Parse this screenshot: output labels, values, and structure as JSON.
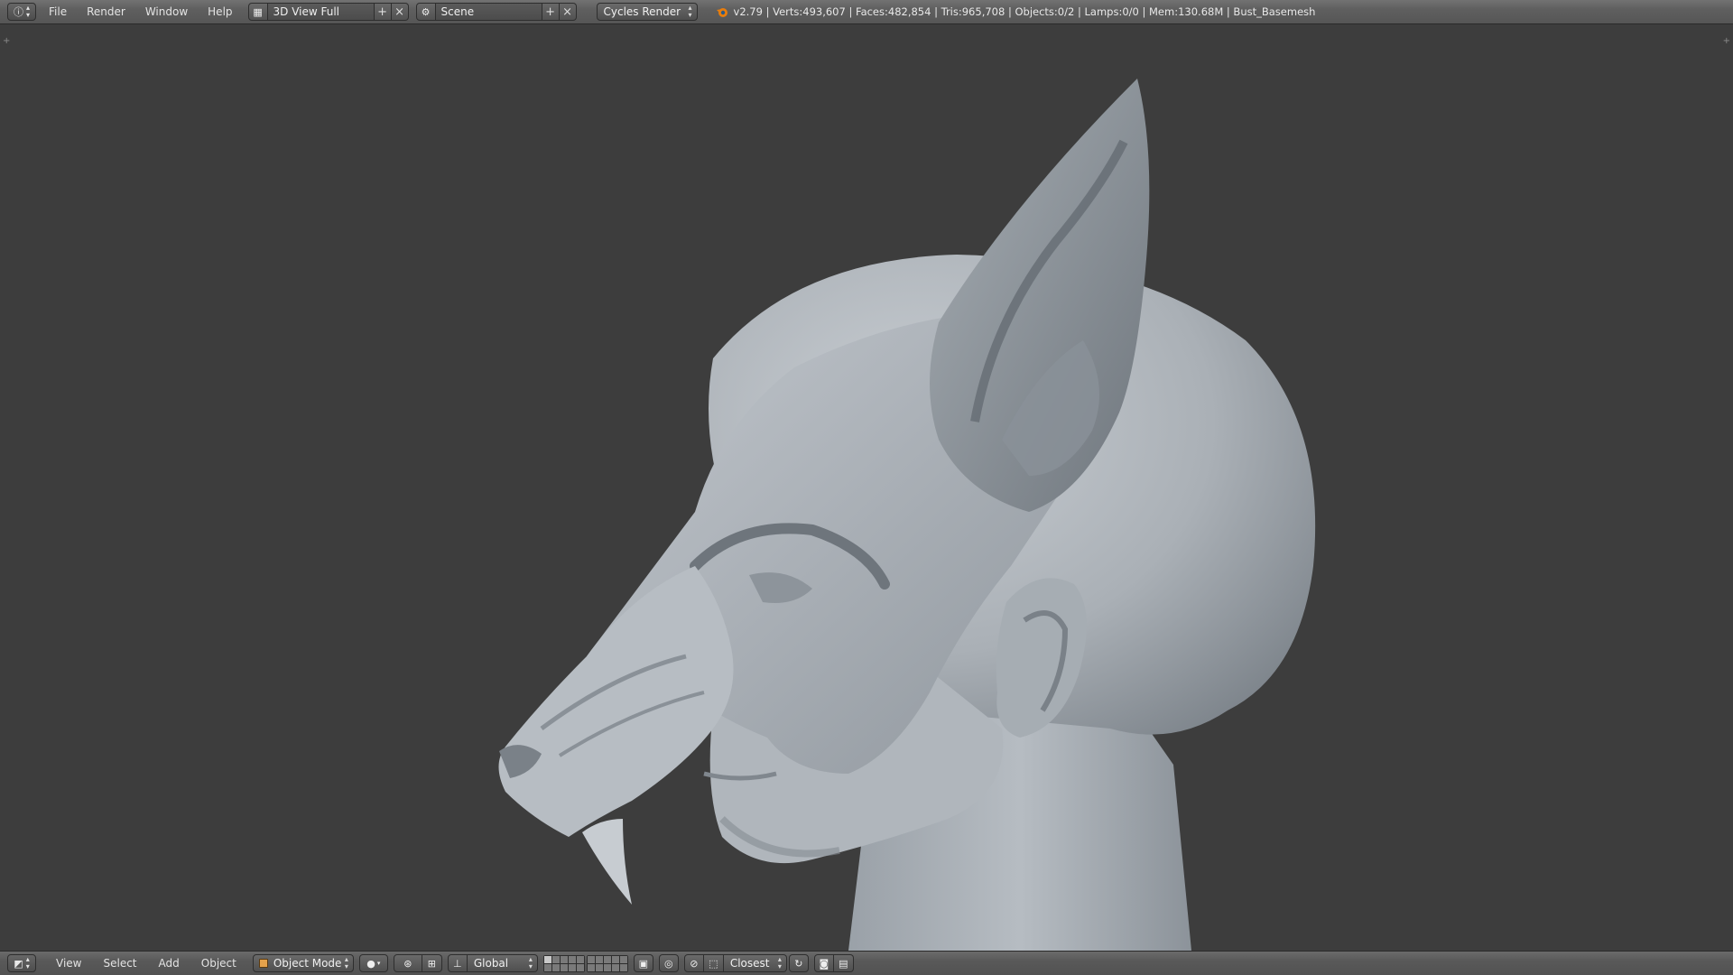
{
  "top": {
    "editor_icon": "info-editor-icon",
    "menus": [
      "File",
      "Render",
      "Window",
      "Help"
    ],
    "screen_layout": "3D View Full",
    "scene": "Scene",
    "render_engine": "Cycles Render",
    "stats": "v2.79 | Verts:493,607 | Faces:482,854 | Tris:965,708 | Objects:0/2 | Lamps:0/0 | Mem:130.68M | Bust_Basemesh"
  },
  "bottom": {
    "editor_icon": "3d-view-editor-icon",
    "menus": [
      "View",
      "Select",
      "Add",
      "Object"
    ],
    "mode": "Object Mode",
    "orientation": "Global",
    "snap_target": "Closest"
  },
  "colors": {
    "viewport_bg": "#3d3d3d",
    "header_bg": "#5f5f5f",
    "clay": "#b4bac0",
    "mode_cube": "#e5a24b"
  }
}
